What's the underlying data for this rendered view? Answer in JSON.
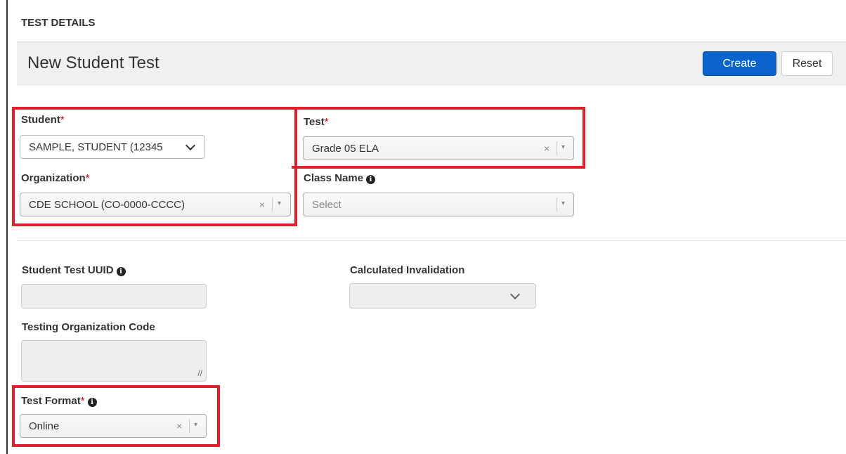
{
  "page": {
    "heading": "TEST DETAILS",
    "title": "New Student Test"
  },
  "toolbar": {
    "create_label": "Create",
    "reset_label": "Reset"
  },
  "form": {
    "student": {
      "label": "Student",
      "required_mark": "*",
      "value": "SAMPLE, STUDENT (12345"
    },
    "test": {
      "label": "Test",
      "required_mark": "*",
      "value": "Grade 05 ELA"
    },
    "organization": {
      "label": "Organization",
      "required_mark": "*",
      "value": "CDE SCHOOL (CO-0000-CCCC)"
    },
    "class_name": {
      "label": "Class Name",
      "placeholder": "Select"
    },
    "student_test_uuid": {
      "label": "Student Test UUID",
      "value": ""
    },
    "calculated_invalidation": {
      "label": "Calculated Invalidation",
      "value": ""
    },
    "testing_org_code": {
      "label": "Testing Organization Code",
      "value": ""
    },
    "test_format": {
      "label": "Test Format",
      "required_mark": "*",
      "value": "Online"
    }
  },
  "icons": {
    "clear": "×",
    "dropdown_caret": "▾",
    "info": "i",
    "resize_grip": "//"
  },
  "colors": {
    "primary_button": "#0a64cc",
    "highlight_box": "#e0202c",
    "required_mark": "#cc0000",
    "title_bar_bg": "#f0f0f0"
  }
}
